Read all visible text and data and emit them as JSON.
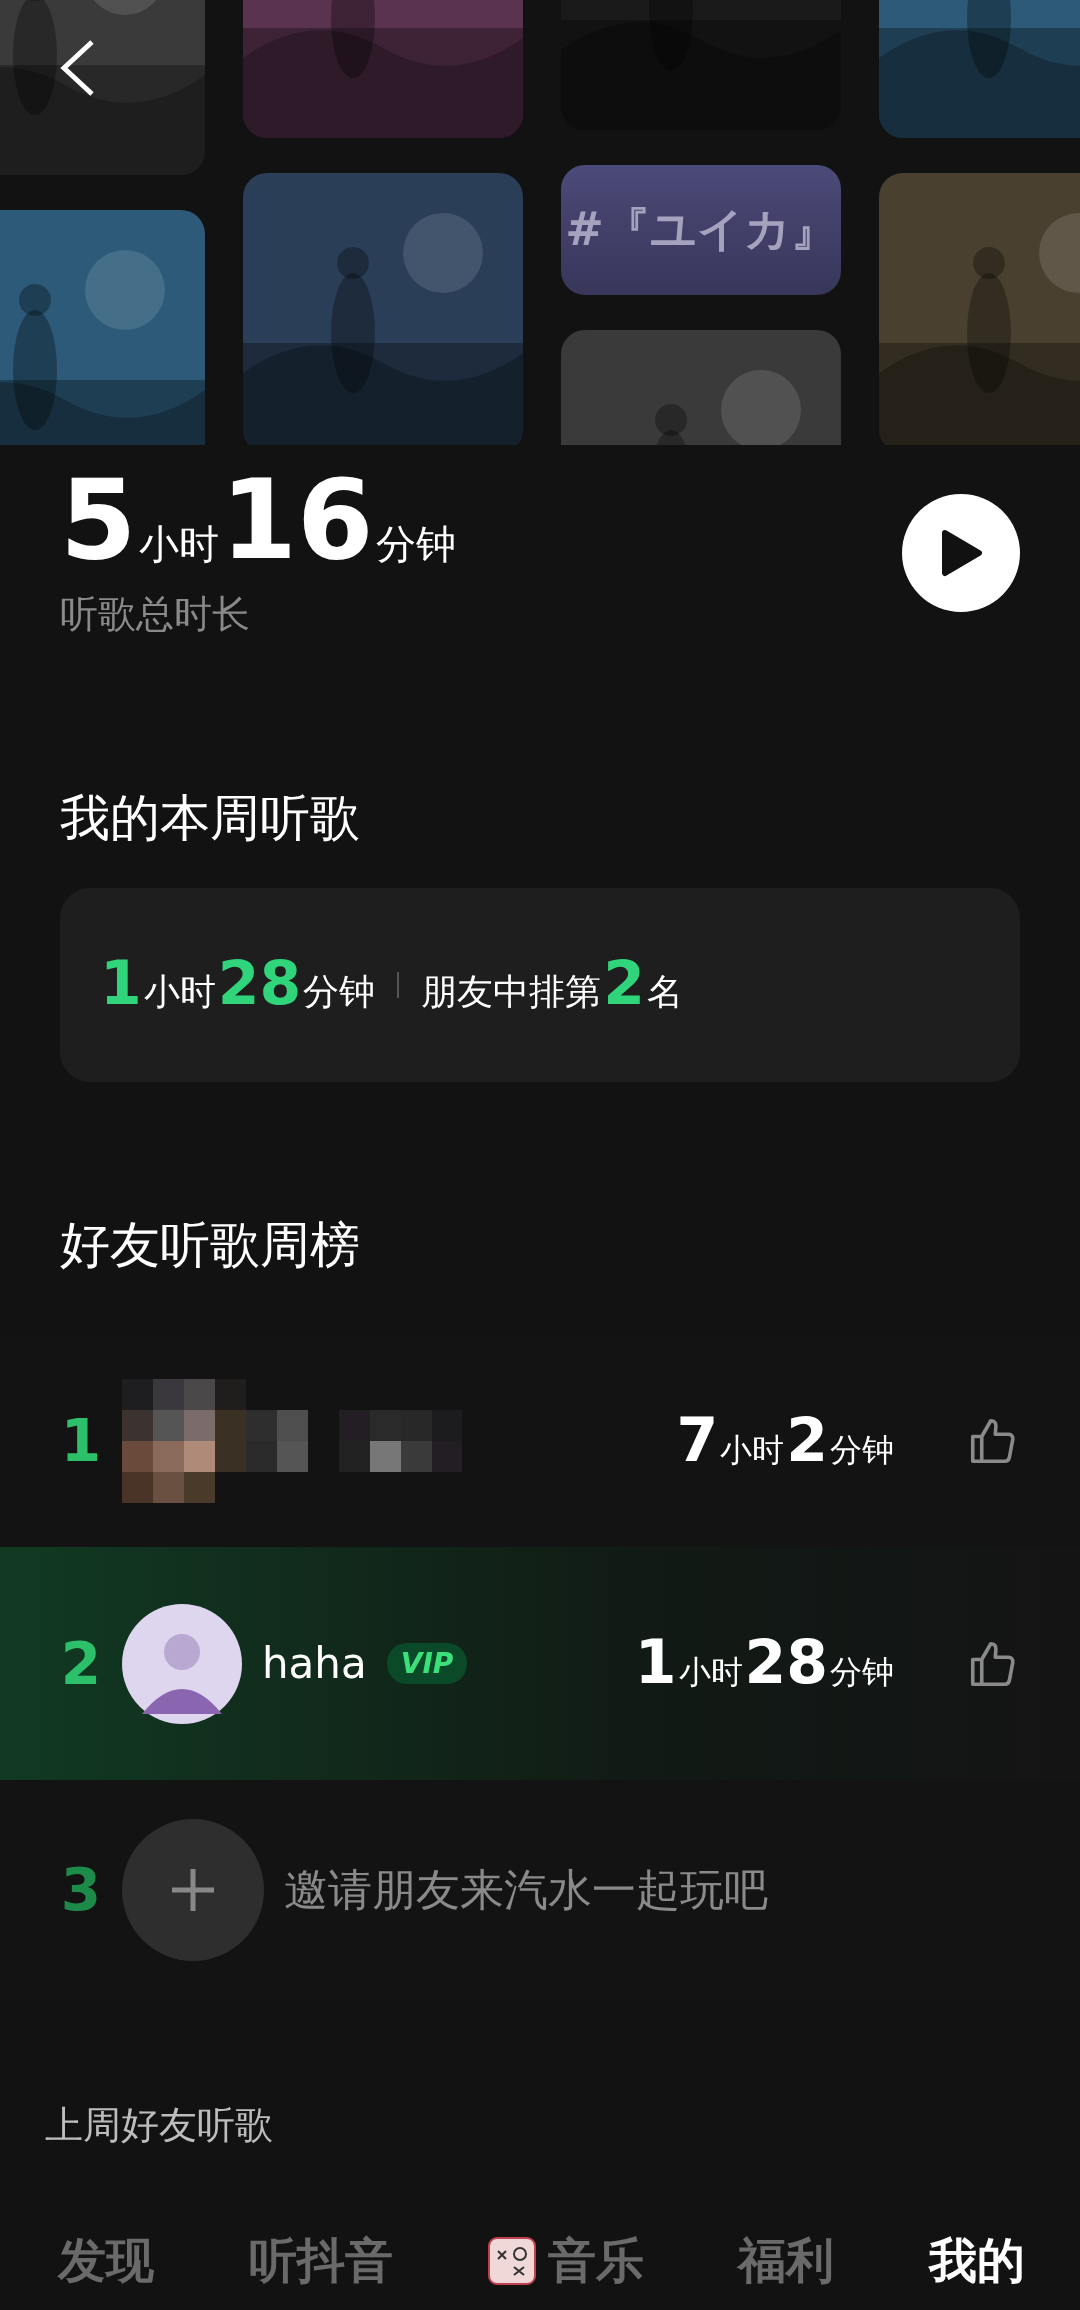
{
  "album_columns": [
    [
      {
        "kind": "picture"
      },
      {
        "kind": "picture"
      }
    ],
    [
      {
        "kind": "picture"
      },
      {
        "kind": "picture"
      }
    ],
    [
      {
        "kind": "picture"
      },
      {
        "kind": "text",
        "text": "#『ユイカ』"
      },
      {
        "kind": "picture"
      }
    ],
    [
      {
        "kind": "picture"
      },
      {
        "kind": "picture"
      }
    ]
  ],
  "total": {
    "duration": [
      {
        "kind": "number",
        "text": "5"
      },
      {
        "kind": "unit",
        "text": "小时"
      },
      {
        "kind": "number",
        "text": "16"
      },
      {
        "kind": "unit",
        "text": "分钟"
      }
    ],
    "label": "听歌总时长"
  },
  "weekly": {
    "title": "我的本周听歌",
    "duration": [
      {
        "kind": "number",
        "text": "1"
      },
      {
        "kind": "unit",
        "text": "小时"
      },
      {
        "kind": "number",
        "text": "28"
      },
      {
        "kind": "unit",
        "text": "分钟"
      }
    ],
    "rank_text": [
      {
        "kind": "unit",
        "text": "朋友中排第"
      },
      {
        "kind": "number",
        "text": "2"
      },
      {
        "kind": "unit",
        "text": "名"
      }
    ]
  },
  "leaderboard": {
    "title": "好友听歌周榜",
    "rows": [
      {
        "kind": "masked",
        "rank": "1",
        "selected": false,
        "duration": [
          {
            "kind": "number",
            "text": "7"
          },
          {
            "kind": "unit",
            "text": "小时"
          },
          {
            "kind": "number",
            "text": "2"
          },
          {
            "kind": "unit",
            "text": "分钟"
          }
        ]
      },
      {
        "kind": "friend",
        "rank": "2",
        "name": "haha",
        "badge": "VIP",
        "selected": true,
        "duration": [
          {
            "kind": "number",
            "text": "1"
          },
          {
            "kind": "unit",
            "text": "小时"
          },
          {
            "kind": "number",
            "text": "28"
          },
          {
            "kind": "unit",
            "text": "分钟"
          }
        ]
      },
      {
        "kind": "invite",
        "rank": "3",
        "selected": false,
        "text": "邀请朋友来汽水一起玩吧"
      }
    ]
  },
  "last_week": "上周好友听歌",
  "nav": [
    {
      "label": "发现",
      "kind": "plain",
      "selected": false
    },
    {
      "label": "听抖音",
      "kind": "plain",
      "selected": false
    },
    {
      "label": "音乐",
      "kind": "cover",
      "selected": false
    },
    {
      "label": "福利",
      "kind": "plain",
      "selected": false
    },
    {
      "label": "我的",
      "kind": "plain",
      "selected": true
    }
  ]
}
